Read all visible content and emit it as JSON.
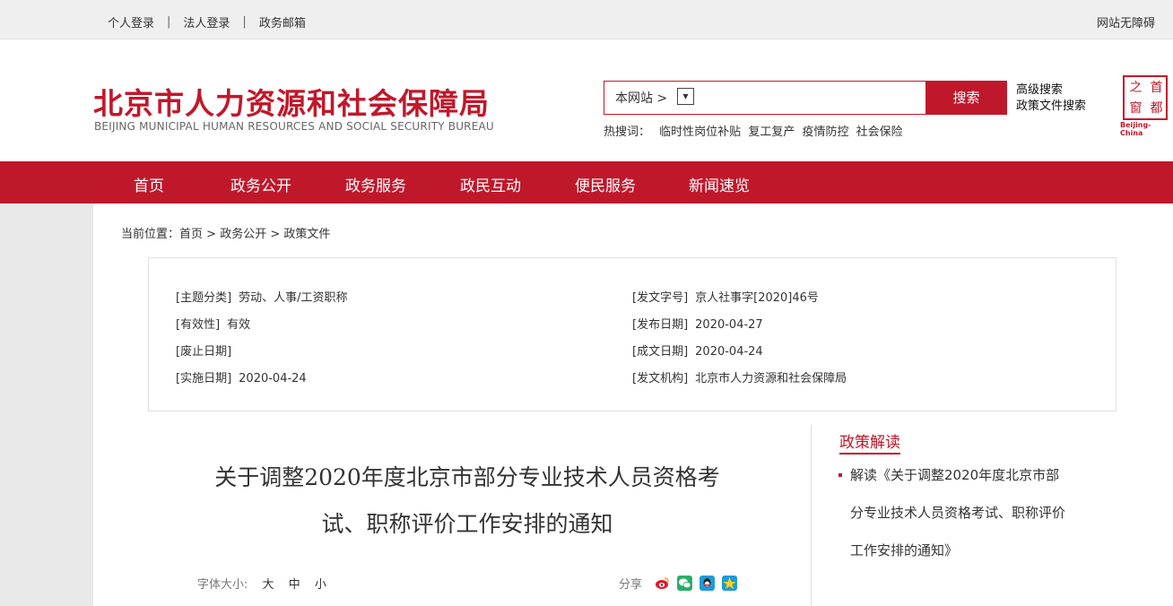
{
  "topbar": {
    "links": [
      "个人登录",
      "法人登录",
      "政务邮箱"
    ],
    "separator": "|",
    "accessibility": "网站无障碍"
  },
  "header": {
    "logo_cn": "北京市人力资源和社会保障局",
    "logo_en": "BEIJING MUNICIPAL HUMAN RESOURCES AND SOCIAL SECURITY BUREAU",
    "search": {
      "scope": "本网站 >",
      "scope_select": "▾",
      "button": "搜索"
    },
    "advanced_search": "高级搜索",
    "policy_search": "政策文件搜索",
    "hot": {
      "label": "热搜词：",
      "keywords": [
        "临时性岗位补贴",
        "复工复产",
        "疫情防控",
        "社会保险"
      ]
    },
    "stamp": {
      "glyphs": [
        "之",
        "首",
        "窗",
        "都"
      ],
      "caption": "Beijing-China"
    }
  },
  "nav": {
    "items": [
      "首页",
      "政务公开",
      "政务服务",
      "政民互动",
      "便民服务",
      "新闻速览"
    ]
  },
  "breadcrumb": {
    "label": "当前位置：",
    "items": [
      "首页",
      "政务公开",
      "政策文件"
    ],
    "sep": " > "
  },
  "meta": {
    "left": [
      {
        "key": "[主题分类]",
        "value": "劳动、人事/工资职称"
      },
      {
        "key": "[有效性]",
        "value": "有效"
      },
      {
        "key": "[废止日期]",
        "value": ""
      },
      {
        "key": "[实施日期]",
        "value": "2020-04-24"
      }
    ],
    "right": [
      {
        "key": "[发文字号]",
        "value": "京人社事字[2020]46号"
      },
      {
        "key": "[发布日期]",
        "value": "2020-04-27"
      },
      {
        "key": "[成文日期]",
        "value": "2020-04-24"
      },
      {
        "key": "[发文机构]",
        "value": "北京市人力资源和社会保障局"
      }
    ]
  },
  "article": {
    "title_line1": "关于调整2020年度北京市部分专业技术人员资格考",
    "title_line2": "试、职称评价工作安排的通知",
    "font_size_label": "字体大小:",
    "font_sizes": [
      "大",
      "中",
      "小"
    ],
    "share_label": "分享",
    "share_icons": [
      "weibo-icon",
      "wechat-icon",
      "qq-icon",
      "qzone-icon"
    ]
  },
  "sidebar": {
    "title": "政策解读",
    "items": [
      {
        "line1": "解读《关于调整2020年度北京市部",
        "line2": "分专业技术人员资格考试、职称评价",
        "line3": "工作安排的通知》"
      }
    ]
  },
  "colors": {
    "brand_red": "#c0182b",
    "page_bg": "#e9e9e9"
  }
}
